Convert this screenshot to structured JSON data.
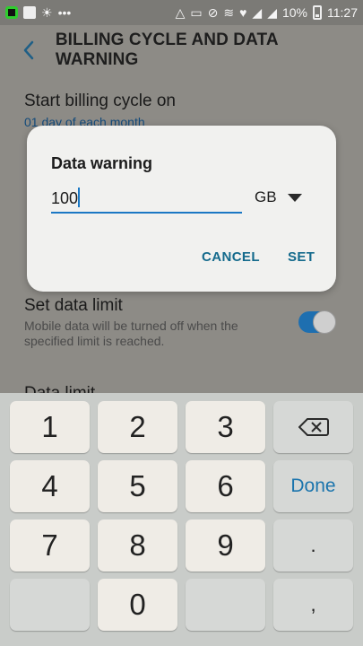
{
  "status_bar": {
    "battery_text": "10%",
    "time": "11:27",
    "icons": [
      "app-icon",
      "flipboard-icon",
      "weather-icon",
      "more-dots-icon",
      "recycle-icon",
      "cast-icon",
      "mute-icon",
      "wifi-icon",
      "heart-icon",
      "signal-icon",
      "signal-icon",
      "battery-icon"
    ]
  },
  "header": {
    "title": "BILLING CYCLE AND DATA WARNING"
  },
  "settings": {
    "billing_title": "Start billing cycle on",
    "billing_value": "01 day of each month",
    "data_limit_title": "Set data limit",
    "data_limit_desc": "Mobile data will be turned off when the specified limit is reached.",
    "data_limit_toggle": "on",
    "data_limit_next": "Data limit"
  },
  "dialog": {
    "title": "Data warning",
    "input_value": "100",
    "unit": "GB",
    "cancel_label": "CANCEL",
    "set_label": "SET"
  },
  "keyboard": {
    "keys": [
      "1",
      "2",
      "3",
      "4",
      "5",
      "6",
      "7",
      "8",
      "9",
      "0",
      ".",
      ","
    ],
    "done_label": "Done",
    "backspace_icon": "backspace-icon"
  },
  "colors": {
    "accent": "#1b78c4",
    "button_text": "#146a8c",
    "toggle_on": "#1e6fb0",
    "dim_overlay": "#8d8b86"
  }
}
